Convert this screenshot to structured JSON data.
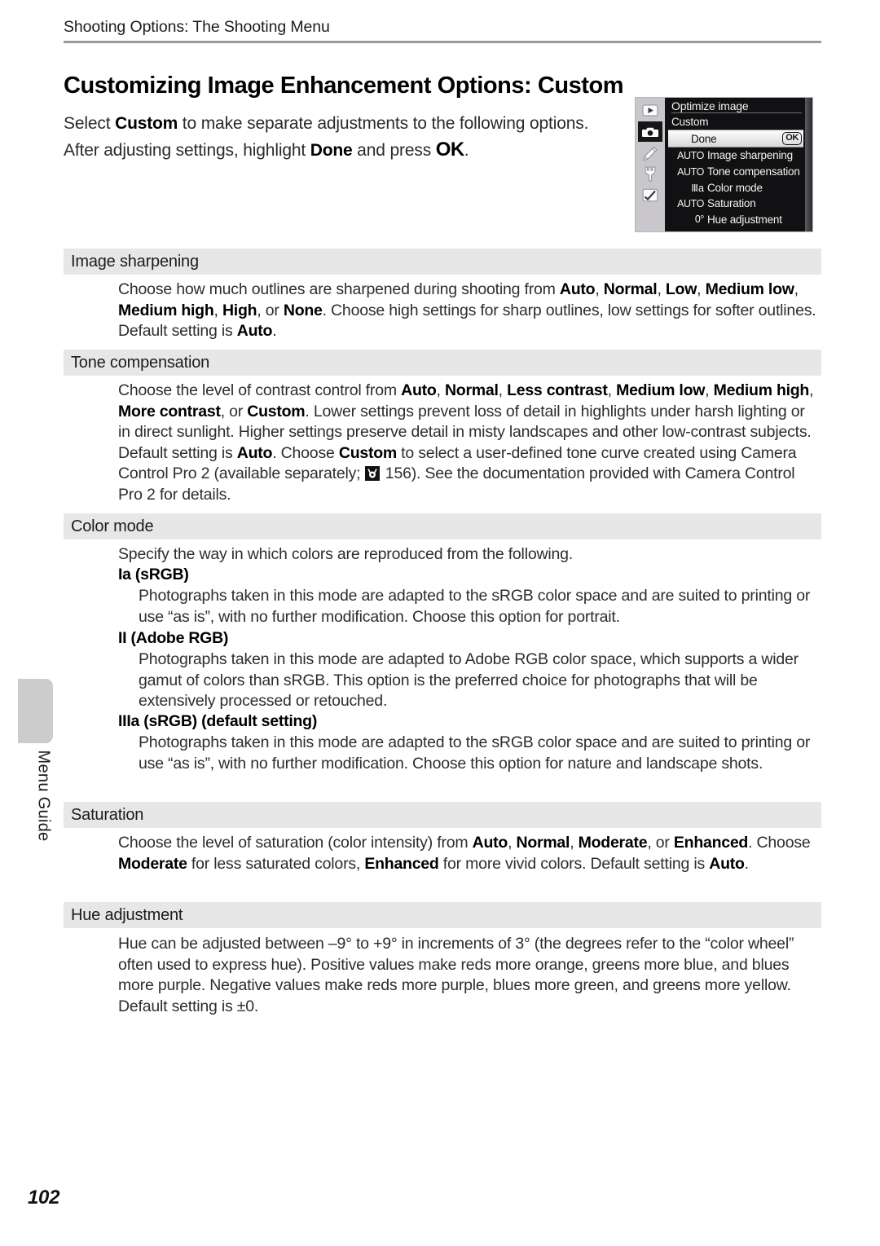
{
  "running_head": "Shooting Options: The Shooting Menu",
  "page_title": "Customizing Image Enhancement Options: Custom",
  "intro": {
    "part1": "Select ",
    "bold1": "Custom",
    "part2": " to make separate adjustments to the following options. After adjusting settings, highlight ",
    "bold2": "Done",
    "part3": " and press ",
    "ok": "OK",
    "part4": "."
  },
  "camera_menu": {
    "header": "Optimize image",
    "subheader": "Custom",
    "selected_row": {
      "label": "Done",
      "badge": "OK"
    },
    "items": [
      {
        "value": "AUTO",
        "label": "Image sharpening"
      },
      {
        "value": "AUTO",
        "label": "Tone compensation"
      },
      {
        "value": "Ⅲa",
        "label": "Color mode"
      },
      {
        "value": "AUTO",
        "label": "Saturation"
      },
      {
        "value": "0°",
        "label": "Hue adjustment"
      }
    ],
    "icons": [
      "playback-icon",
      "shooting-menu-icon",
      "custom-settings-pencil-icon",
      "setup-wrench-icon",
      "retouch-icon"
    ]
  },
  "sections": [
    {
      "heading": "Image sharpening",
      "body_html": "Choose how much outlines are sharpened during shooting from <b>Auto</b>, <b>Normal</b>, <b>Low</b>, <b>Medium low</b>, <b>Medium high</b>, <b>High</b>, or <b>None</b>. Choose high settings for sharp outlines, low settings for softer outlines. Default setting is <b>Auto</b>."
    },
    {
      "heading": "Tone compensation",
      "body_html": "Choose the level of contrast control from <b>Auto</b>, <b>Normal</b>, <b>Less contrast</b>, <b>Medium low</b>, <b>Medium high</b>, <b>More contrast</b>, or <b>Custom</b>. Lower settings prevent loss of detail in highlights under harsh lighting or in direct sunlight. Higher settings preserve detail in misty landscapes and other low-contrast subjects. Default setting is <b>Auto</b>. Choose <b>Custom</b> to select a user-defined tone curve created using Camera Control Pro 2 (available separately; <span class=\"refglyph\" data-name=\"page-reference-icon\"><svg width=\"18\" height=\"18\" viewBox=\"0 0 18 18\"><circle cx=\"9\" cy=\"10.5\" r=\"4\" fill=\"#fff\"/><path d=\"M4 3.5 L6.5 8.5 M14 3.5 L11.5 8.5\" stroke=\"#fff\" stroke-width=\"1.6\" fill=\"none\"/><circle cx=\"9\" cy=\"10.5\" r=\"1.6\" fill=\"#111\"/></svg></span> 156). See the documentation provided with Camera Control Pro 2 for details."
    },
    {
      "heading": "Color mode",
      "body_html": "Specify the way in which colors are reproduced from the following.",
      "subsections": [
        {
          "title": "Ia (sRGB)",
          "text": "Photographs taken in this mode are adapted to the sRGB color space and are suited to printing or use “as is”, with no further modification. Choose this option for portrait."
        },
        {
          "title": "II (Adobe RGB)",
          "text": "Photographs taken in this mode are adapted to Adobe RGB color space, which supports a wider gamut of colors than sRGB. This option is the preferred choice for photographs that will be extensively processed or retouched."
        },
        {
          "title": "IIIa (sRGB) (default setting)",
          "text": "Photographs taken in this mode are adapted to the sRGB color space and are suited to printing or use “as is”, with no further modification. Choose this option for nature and landscape shots."
        }
      ]
    },
    {
      "heading": "Saturation",
      "body_html": "Choose the level of saturation (color intensity) from <b>Auto</b>, <b>Normal</b>, <b>Moderate</b>, or <b>Enhanced</b>. Choose <b>Moderate</b> for less saturated colors, <b>Enhanced</b> for more vivid colors. Default setting is <b>Auto</b>."
    },
    {
      "heading": "Hue adjustment",
      "body_html": "Hue can be adjusted between –9° to +9° in increments of 3° (the degrees refer to the “color wheel” often used to express hue). Positive values make reds more orange, greens more blue, and blues more purple. Negative values make reds more purple, blues more green, and greens more yellow. Default setting is ±0."
    }
  ],
  "side_tab_label": "Menu Guide",
  "page_number": "102",
  "colors": {
    "section_bar": "#e7e7e7",
    "tab_gray": "#cccccc",
    "rule": "#9a9a9a",
    "menu_bg": "#111113"
  }
}
